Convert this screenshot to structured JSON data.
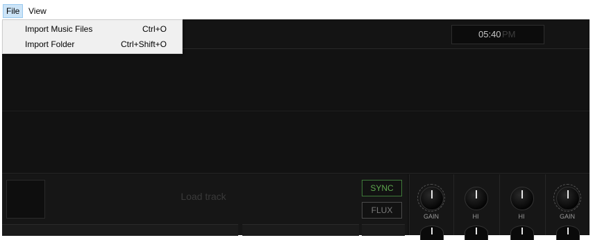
{
  "menubar": {
    "items": [
      {
        "label": "File"
      },
      {
        "label": "View"
      }
    ]
  },
  "file_menu": {
    "items": [
      {
        "label": "Import Music Files",
        "shortcut": "Ctrl+O"
      },
      {
        "label": "Import Folder",
        "shortcut": "Ctrl+Shift+O"
      }
    ]
  },
  "clock": {
    "time": "05:40",
    "ampm": "PM"
  },
  "deck": {
    "placeholder": "Load track",
    "sync_label": "SYNC",
    "flux_label": "FLUX"
  },
  "mixer": {
    "knobs": [
      {
        "label": "GAIN"
      },
      {
        "label": "HI"
      },
      {
        "label": "HI"
      },
      {
        "label": "GAIN"
      }
    ]
  },
  "colors": {
    "sync_accent": "#5fa84f",
    "app_background": "#111111"
  }
}
